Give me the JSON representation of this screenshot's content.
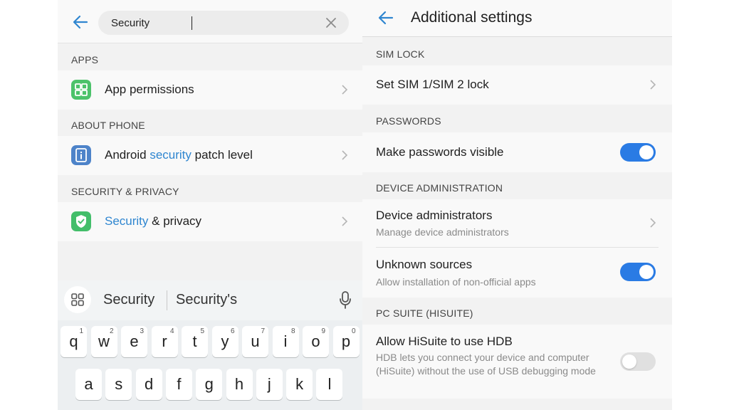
{
  "colors": {
    "accent": "#2f86d0",
    "toggle_on": "#2a7be4",
    "toggle_off": "#e0e0e0",
    "highlight": "#2f86d0"
  },
  "left": {
    "search": {
      "value": "Security",
      "placeholder": ""
    },
    "sections": {
      "apps": "APPS",
      "about_phone": "ABOUT PHONE",
      "security_privacy": "SECURITY & PRIVACY"
    },
    "results": {
      "app_permissions": {
        "label": "App permissions",
        "icon": "grid-icon"
      },
      "patch": {
        "pre": "Android ",
        "match": "security",
        "post": " patch level",
        "icon": "info-icon"
      },
      "sec_privacy": {
        "match": "Security",
        "post": " & privacy",
        "icon": "shield-check-icon"
      }
    },
    "keyboard": {
      "suggestions": [
        "Security",
        "Security's"
      ],
      "row1": [
        {
          "k": "q",
          "n": "1"
        },
        {
          "k": "w",
          "n": "2"
        },
        {
          "k": "e",
          "n": "3"
        },
        {
          "k": "r",
          "n": "4"
        },
        {
          "k": "t",
          "n": "5"
        },
        {
          "k": "y",
          "n": "6"
        },
        {
          "k": "u",
          "n": "7"
        },
        {
          "k": "i",
          "n": "8"
        },
        {
          "k": "o",
          "n": "9"
        },
        {
          "k": "p",
          "n": "0"
        }
      ],
      "row2": [
        "a",
        "s",
        "d",
        "f",
        "g",
        "h",
        "j",
        "k",
        "l"
      ]
    }
  },
  "right": {
    "title": "Additional settings",
    "sim_lock": {
      "header": "SIM LOCK",
      "item": "Set SIM 1/SIM 2 lock"
    },
    "passwords": {
      "header": "PASSWORDS",
      "item": "Make passwords visible",
      "toggle": true
    },
    "device_admin": {
      "header": "DEVICE ADMINISTRATION",
      "admins": {
        "label": "Device administrators",
        "sub": "Manage device administrators"
      },
      "unknown": {
        "label": "Unknown sources",
        "sub": "Allow installation of non-official apps",
        "toggle": true
      }
    },
    "pc_suite": {
      "header": "PC SUITE (HISUITE)",
      "hdb": {
        "label": "Allow HiSuite to use HDB",
        "sub": "HDB lets you connect your device and computer (HiSuite) without the use of USB debugging mode",
        "toggle": false
      }
    }
  }
}
